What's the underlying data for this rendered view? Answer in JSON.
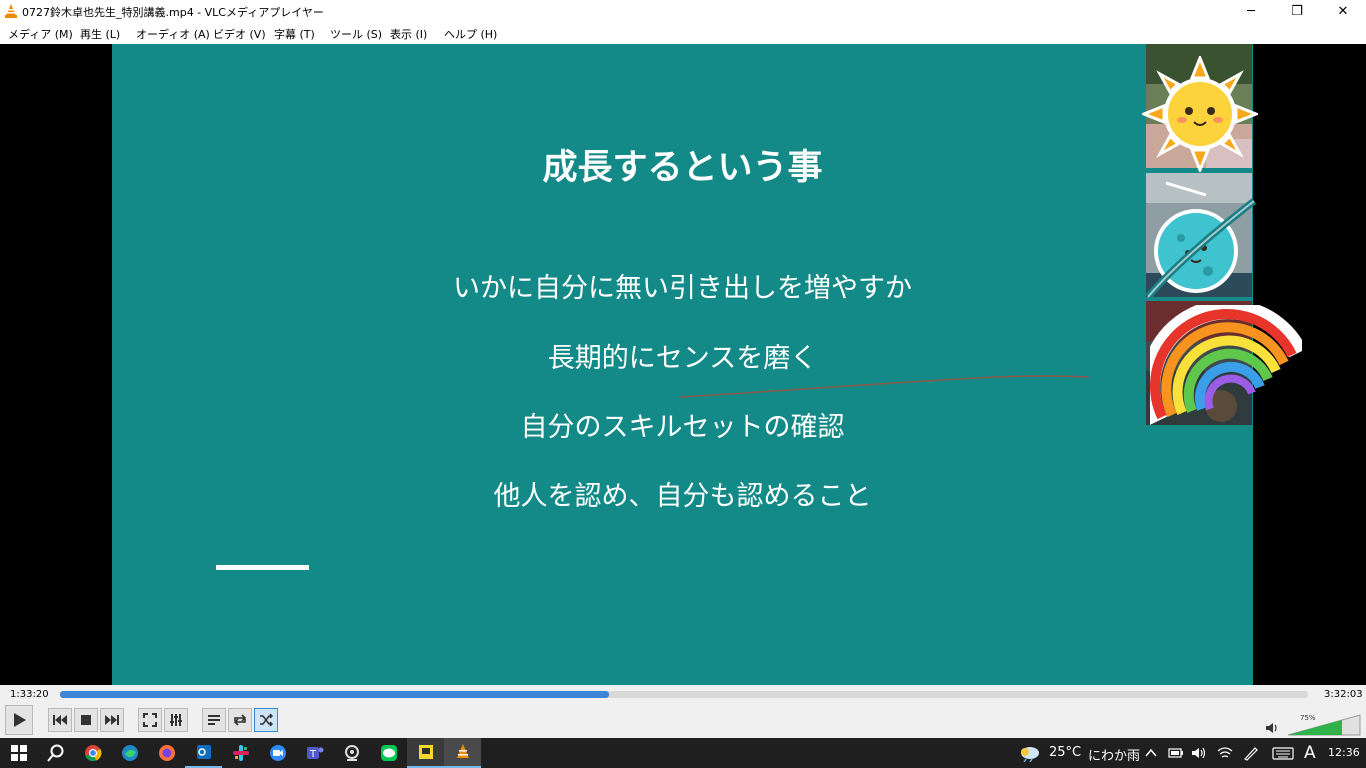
{
  "window": {
    "title": "0727鈴木卓也先生_特別講義.mp4 - VLCメディアプレイヤー",
    "minimize_glyph": "─",
    "maximize_glyph": "❐",
    "close_glyph": "✕"
  },
  "menu": {
    "items": [
      "メディア (M)",
      "再生 (L)",
      "オーディオ (A)",
      "ビデオ (V)",
      "字幕 (T)",
      "ツール (S)",
      "表示 (I)",
      "ヘルプ (H)"
    ]
  },
  "slide": {
    "title": "成長するという事",
    "bullets": [
      "いかに自分に無い引き出しを増やすか",
      "長期的にセンスを磨く",
      "自分のスキルセットの確認",
      "他人を認め、自分も認めること"
    ],
    "background": "#138a87"
  },
  "participants": [
    {
      "sticker": "sun-sticker"
    },
    {
      "sticker": "planet-sticker"
    },
    {
      "sticker": "rainbow-sticker"
    }
  ],
  "player": {
    "elapsed": "1:33:20",
    "total": "3:32:03",
    "progress_fraction": 0.44,
    "volume_percent": "75%",
    "volume_fraction": 0.75,
    "accent": "#3d86d6"
  },
  "taskbar": {
    "apps": [
      "search-icon",
      "chrome-icon",
      "edge-icon",
      "firefox-icon",
      "outlook-icon",
      "slack-icon",
      "zoom-icon",
      "teams-icon",
      "webcam-app-icon",
      "line-icon",
      "sticky-notes-icon",
      "vlc-icon"
    ],
    "weather": {
      "temperature": "25°C",
      "condition": "にわか雨"
    },
    "ime": "A",
    "clock": "12:36"
  }
}
